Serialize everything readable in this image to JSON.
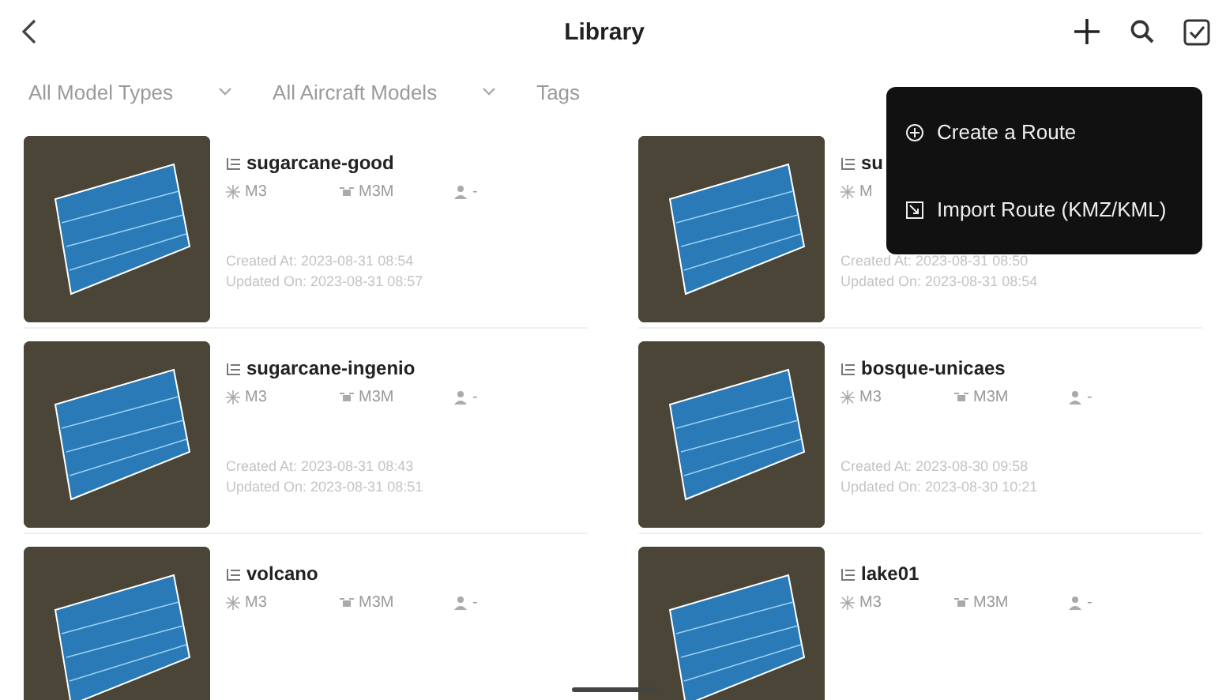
{
  "header": {
    "title": "Library"
  },
  "filters": [
    {
      "label": "All Model Types",
      "kind": "dropdown"
    },
    {
      "label": "All Aircraft Models",
      "kind": "dropdown"
    },
    {
      "label": "Tags",
      "kind": "plain"
    }
  ],
  "menu": {
    "items": [
      {
        "label": "Create a Route",
        "kind": "create"
      },
      {
        "label": "Import Route (KMZ/KML)",
        "kind": "import"
      }
    ]
  },
  "routes": [
    {
      "name": "sugarcane-good",
      "model_type": "M3",
      "aircraft": "M3M",
      "user": "-",
      "created": "Created At: 2023-08-31 08:54",
      "updated": "Updated On: 2023-08-31 08:57"
    },
    {
      "name": "su",
      "model_type": "M",
      "created": "Created At: 2023-08-31 08:50",
      "updated": "Updated On: 2023-08-31 08:54"
    },
    {
      "name": "sugarcane-ingenio",
      "model_type": "M3",
      "aircraft": "M3M",
      "user": "-",
      "created": "Created At: 2023-08-31 08:43",
      "updated": "Updated On: 2023-08-31 08:51"
    },
    {
      "name": "bosque-unicaes",
      "model_type": "M3",
      "aircraft": "M3M",
      "user": "-",
      "created": "Created At: 2023-08-30 09:58",
      "updated": "Updated On: 2023-08-30 10:21"
    },
    {
      "name": "volcano",
      "model_type": "M3",
      "aircraft": "M3M",
      "user": "-"
    },
    {
      "name": "lake01",
      "model_type": "M3",
      "aircraft": "M3M",
      "user": "-"
    }
  ]
}
